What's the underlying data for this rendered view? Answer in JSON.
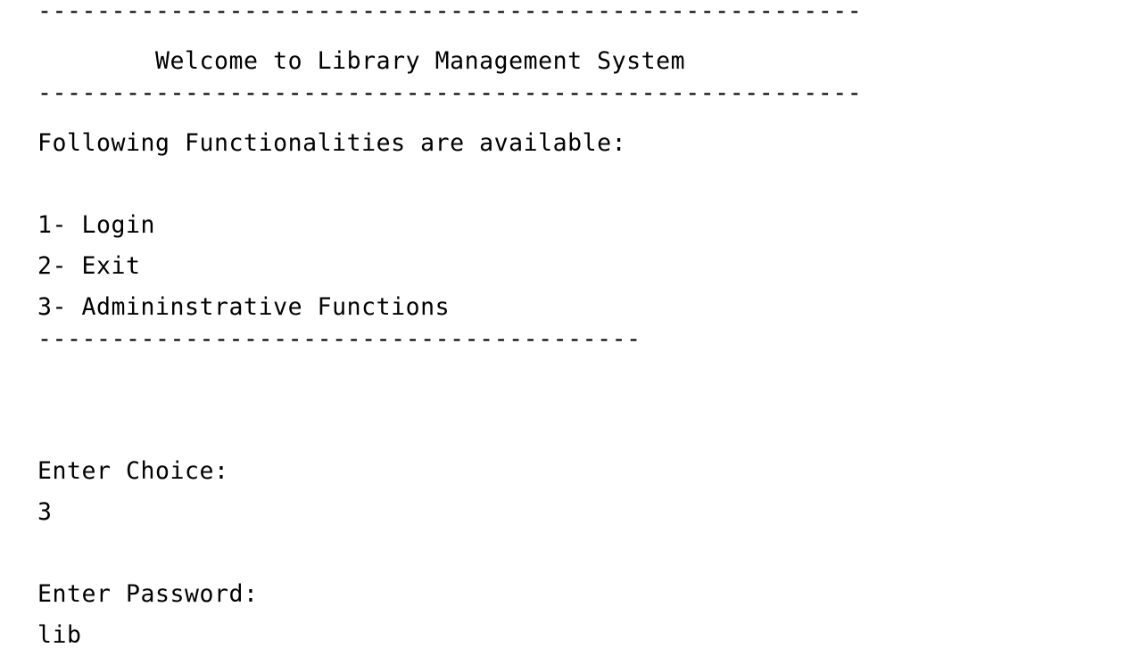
{
  "app": {
    "title": "Welcome to Library Management System",
    "type": "console",
    "foreground_color": "#000000",
    "background_color": "#ffffff"
  },
  "separators": {
    "top_rule": "--------------------------------------------------------",
    "title_rule": "--------------------------------------------------------",
    "menu_rule": "-----------------------------------------"
  },
  "header": {
    "title_line": "        Welcome to Library Management System"
  },
  "menu": {
    "heading": "Following Functionalities are available:",
    "items": [
      {
        "key": "1",
        "label": "Login",
        "line": "1- Login"
      },
      {
        "key": "2",
        "label": "Exit",
        "line": "2- Exit"
      },
      {
        "key": "3",
        "label": "Admininstrative Functions",
        "line": "3- Admininstrative Functions"
      }
    ]
  },
  "prompts": {
    "choice_label": "Enter Choice:",
    "choice_value": "3",
    "password_label": "Enter Password:",
    "password_value": "lib"
  }
}
